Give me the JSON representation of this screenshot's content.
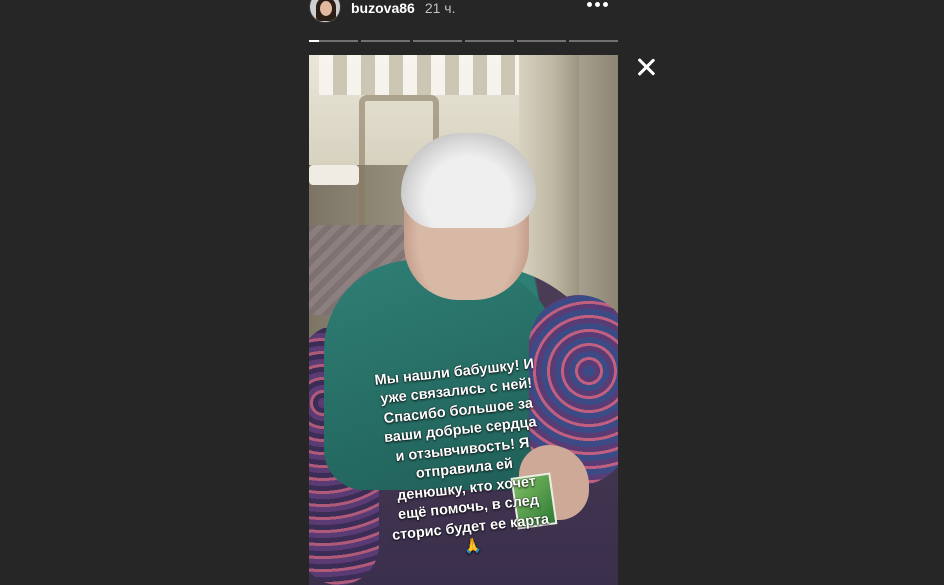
{
  "header": {
    "username": "buzova86",
    "time": "21 ч."
  },
  "progress": {
    "segments": 6,
    "current_index": 0,
    "current_fill": 0.2
  },
  "story": {
    "caption": "Мы нашли бабушку! И\nуже связались с ней!\nСпасибо большое за\nваши добрые сердца\nи отзывчивость! Я\nотправила ей\nденюшку, кто хочет\nещё помочь, в след\nсторис будет ее карта\n🙏"
  },
  "icons": {
    "more": "more-horizontal-icon",
    "close": "close-icon"
  },
  "colors": {
    "background": "#262626",
    "text": "#ffffff",
    "muted": "#bfbfbf"
  }
}
